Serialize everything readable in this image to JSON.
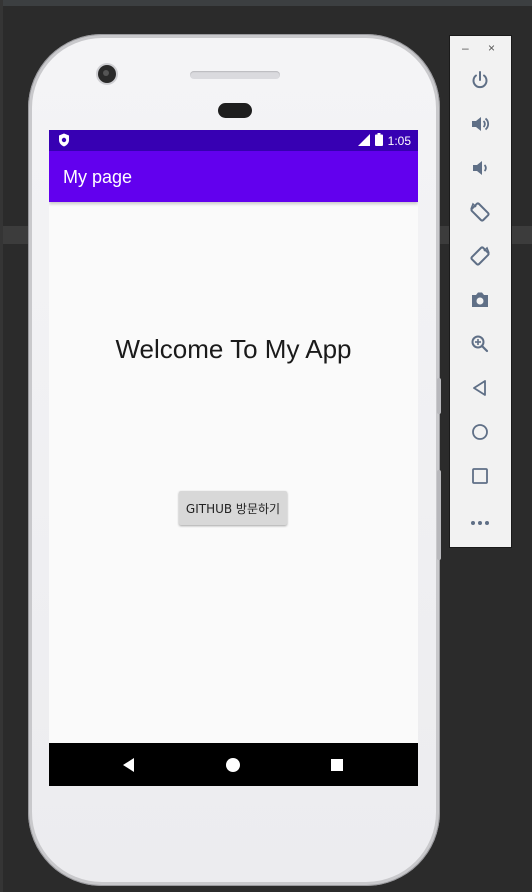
{
  "status_bar": {
    "time": "1:05"
  },
  "app_bar": {
    "title": "My page"
  },
  "content": {
    "welcome_text": "Welcome To My App",
    "github_button_label": "GITHUB 방문하기"
  },
  "toolbar": {
    "minimize_glyph": "–",
    "close_glyph": "×",
    "buttons": [
      {
        "name": "power",
        "icon": "power-icon"
      },
      {
        "name": "volume-up",
        "icon": "volume-up-icon"
      },
      {
        "name": "volume-down",
        "icon": "volume-down-icon"
      },
      {
        "name": "rotate-left",
        "icon": "rotate-left-icon"
      },
      {
        "name": "rotate-right",
        "icon": "rotate-right-icon"
      },
      {
        "name": "screenshot",
        "icon": "camera-icon"
      },
      {
        "name": "zoom",
        "icon": "zoom-in-icon"
      },
      {
        "name": "back",
        "icon": "back-icon"
      },
      {
        "name": "home",
        "icon": "home-icon"
      },
      {
        "name": "overview",
        "icon": "overview-icon"
      },
      {
        "name": "more",
        "icon": "more-icon"
      }
    ]
  },
  "colors": {
    "status_bar": "#3700b3",
    "app_bar": "#6200ee",
    "screen_background": "#fafafa",
    "ide_background": "#2b2b2b",
    "toolbar_icon": "#5f6f86"
  }
}
